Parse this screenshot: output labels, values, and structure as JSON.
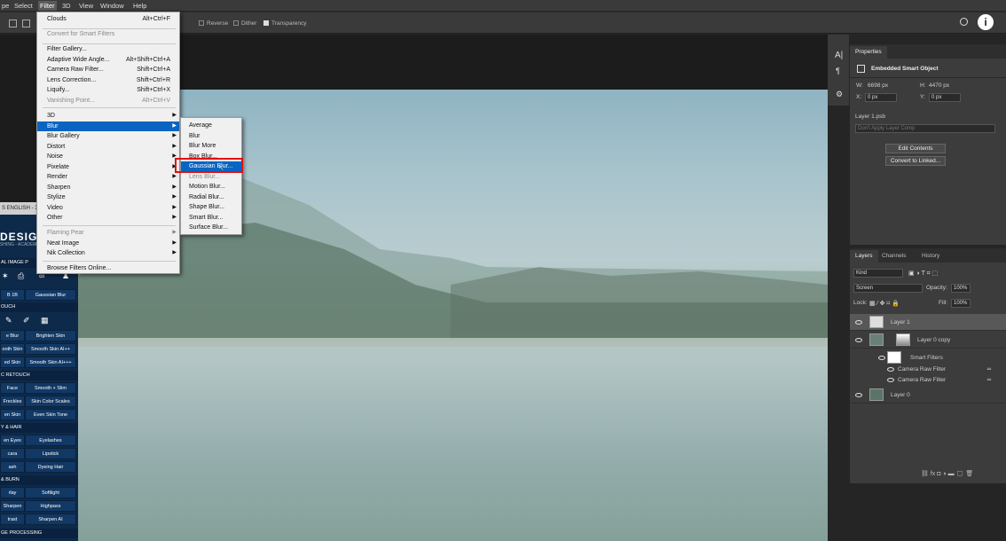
{
  "menubar": {
    "items": [
      "pe",
      "Select",
      "Filter",
      "3D",
      "View",
      "Window",
      "Help"
    ]
  },
  "options": {
    "reverse": "Reverse",
    "dither": "Dither",
    "transparency": "Transparency"
  },
  "filter_menu": {
    "top": [
      {
        "label": "Clouds",
        "shortcut": "Alt+Ctrl+F"
      },
      {
        "label": "Convert for Smart Filters",
        "disabled": true
      }
    ],
    "group2": [
      {
        "label": "Filter Gallery...",
        "shortcut": ""
      },
      {
        "label": "Adaptive Wide Angle...",
        "shortcut": "Alt+Shift+Ctrl+A"
      },
      {
        "label": "Camera Raw Filter...",
        "shortcut": "Shift+Ctrl+A"
      },
      {
        "label": "Lens Correction...",
        "shortcut": "Shift+Ctrl+R"
      },
      {
        "label": "Liquify...",
        "shortcut": "Shift+Ctrl+X"
      },
      {
        "label": "Vanishing Point...",
        "shortcut": "Alt+Ctrl+V"
      }
    ],
    "group3": [
      "3D",
      "Blur",
      "Blur Gallery",
      "Distort",
      "Noise",
      "Pixelate",
      "Render",
      "Sharpen",
      "Stylize",
      "Video",
      "Other"
    ],
    "group4": [
      "Flaming Pear",
      "Neat Image",
      "Nik Collection"
    ],
    "browse": "Browse Filters Online..."
  },
  "blur_submenu": {
    "items": [
      "Average",
      "Blur",
      "Blur More",
      "Box Blur...",
      "Gaussian Blur...",
      "Lens Blur...",
      "Motion Blur...",
      "Radial Blur...",
      "Shape Blur...",
      "Smart Blur...",
      "Surface Blur..."
    ]
  },
  "plugin": {
    "header": "S ENGLISH - 3.",
    "logo": "DESIGN",
    "logo_sub": "SHING - ACADEM",
    "section_main": "AL IMAGE P",
    "gaussian_btn": "Gaussian Blur",
    "b1b": "B 1B",
    "rows": [
      {
        "section": "OUCH"
      },
      {
        "a": "e Blur",
        "b": "Brighten Skin"
      },
      {
        "a": "ooth Skin",
        "b": "Smooth Skin AI++"
      },
      {
        "a": "ed Skin",
        "b": "Smooth Skin AI+++"
      },
      {
        "section": "C RETOUCH"
      },
      {
        "a": "Face",
        "b": "Smooth + Slim"
      },
      {
        "a": "Freckles",
        "b": "Skin Color Scales"
      },
      {
        "a": "en Skin",
        "b": "Even Skin Tone"
      },
      {
        "section": "Y & HAIR"
      },
      {
        "a": "en Eyes",
        "b": "Eyelashes"
      },
      {
        "a": "cara",
        "b": "Lipstick"
      },
      {
        "a": "ash",
        "b": "Dyeing Hair"
      },
      {
        "section": "& BURN"
      },
      {
        "a": "rlay",
        "b": "Softlight"
      },
      {
        "a": "Sharpen",
        "b": "Highpass"
      },
      {
        "a": "trast",
        "b": "Sharpen AI"
      },
      {
        "section": "GE PROCESSING"
      }
    ]
  },
  "properties": {
    "tab": "Properties",
    "kind": "Embedded Smart Object",
    "w_label": "W:",
    "w_value": "6698 px",
    "h_label": "H:",
    "h_value": "4470 px",
    "x_label": "X:",
    "x_value": "0 px",
    "y_label": "Y:",
    "y_value": "0 px",
    "file": "Layer 1.psb",
    "comp": "Don't Apply Layer Comp",
    "edit_btn": "Edit Contents",
    "convert_btn": "Convert to Linked..."
  },
  "layers_panel": {
    "tabs": [
      "Layers",
      "Channels",
      "History"
    ],
    "kind": "Kind",
    "blend": "Screen",
    "opacity_label": "Opacity:",
    "opacity": "100%",
    "lock_label": "Lock:",
    "fill_label": "Fill:",
    "fill": "100%",
    "layers": [
      {
        "name": "Layer 1",
        "selected": true
      },
      {
        "name": "Layer 0 copy",
        "selected": false
      },
      {
        "name": "Smart Filters",
        "sub": true
      },
      {
        "name": "Camera Raw Filter",
        "sub2": true
      },
      {
        "name": "Camera Raw Filter",
        "sub2": true
      },
      {
        "name": "Layer 0",
        "selected": false
      }
    ]
  },
  "colors": {
    "highlight": "#0a64c2",
    "callout": "#e01010",
    "plugin_bg": "#0e2a4a"
  }
}
